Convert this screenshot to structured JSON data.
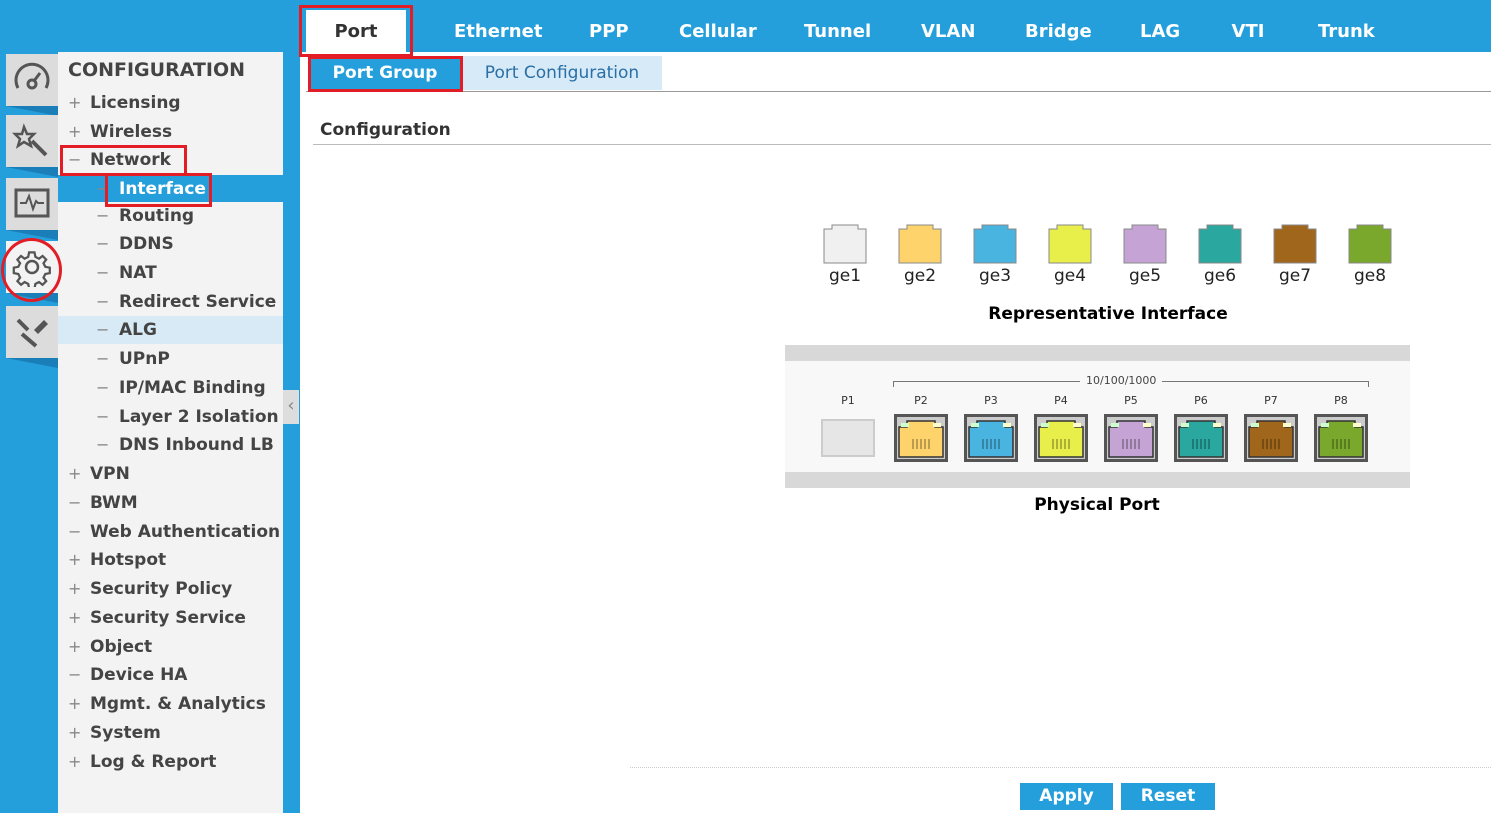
{
  "tabs": [
    "Port",
    "Ethernet",
    "PPP",
    "Cellular",
    "Tunnel",
    "VLAN",
    "Bridge",
    "LAG",
    "VTI",
    "Trunk"
  ],
  "subtabs": [
    "Port Group",
    "Port Configuration"
  ],
  "sidebar": {
    "title": "CONFIGURATION",
    "items": [
      {
        "label": "Licensing",
        "sign": "+",
        "level": 0
      },
      {
        "label": "Wireless",
        "sign": "+",
        "level": 0
      },
      {
        "label": "Network",
        "sign": "−",
        "level": 0
      },
      {
        "label": "Interface",
        "sign": "−",
        "level": 1,
        "selected": true
      },
      {
        "label": "Routing",
        "sign": "−",
        "level": 1
      },
      {
        "label": "DDNS",
        "sign": "−",
        "level": 1
      },
      {
        "label": "NAT",
        "sign": "−",
        "level": 1
      },
      {
        "label": "Redirect Service",
        "sign": "−",
        "level": 1
      },
      {
        "label": "ALG",
        "sign": "−",
        "level": 1,
        "hover": true
      },
      {
        "label": "UPnP",
        "sign": "−",
        "level": 1
      },
      {
        "label": "IP/MAC Binding",
        "sign": "−",
        "level": 1
      },
      {
        "label": "Layer 2 Isolation",
        "sign": "−",
        "level": 1
      },
      {
        "label": "DNS Inbound LB",
        "sign": "−",
        "level": 1
      },
      {
        "label": "VPN",
        "sign": "+",
        "level": 0
      },
      {
        "label": "BWM",
        "sign": "−",
        "level": 0
      },
      {
        "label": "Web Authentication",
        "sign": "−",
        "level": 0
      },
      {
        "label": "Hotspot",
        "sign": "+",
        "level": 0
      },
      {
        "label": "Security Policy",
        "sign": "+",
        "level": 0
      },
      {
        "label": "Security Service",
        "sign": "+",
        "level": 0
      },
      {
        "label": "Object",
        "sign": "+",
        "level": 0
      },
      {
        "label": "Device HA",
        "sign": "−",
        "level": 0
      },
      {
        "label": "Mgmt. & Analytics",
        "sign": "+",
        "level": 0
      },
      {
        "label": "System",
        "sign": "+",
        "level": 0
      },
      {
        "label": "Log & Report",
        "sign": "+",
        "level": 0
      }
    ]
  },
  "icons": [
    "dashboard-icon",
    "wizard-icon",
    "monitor-icon",
    "gear-icon",
    "maintenance-icon"
  ],
  "main": {
    "section_title": "Configuration",
    "rep_caption": "Representative Interface",
    "phys_caption": "Physical Port",
    "speed_label": "10/100/1000",
    "interfaces": [
      {
        "name": "ge1",
        "color": "#f0f0f0"
      },
      {
        "name": "ge2",
        "color": "#ffd36b"
      },
      {
        "name": "ge3",
        "color": "#4ab4e0"
      },
      {
        "name": "ge4",
        "color": "#e8ef4a"
      },
      {
        "name": "ge5",
        "color": "#c5a3d5"
      },
      {
        "name": "ge6",
        "color": "#2aa79f"
      },
      {
        "name": "ge7",
        "color": "#a0661c"
      },
      {
        "name": "ge8",
        "color": "#7aa82c"
      }
    ],
    "ports": [
      {
        "name": "P1",
        "color": "#e6e6e6"
      },
      {
        "name": "P2",
        "color": "#ffd36b"
      },
      {
        "name": "P3",
        "color": "#4ab4e0"
      },
      {
        "name": "P4",
        "color": "#e8ef4a"
      },
      {
        "name": "P5",
        "color": "#c5a3d5"
      },
      {
        "name": "P6",
        "color": "#2aa79f"
      },
      {
        "name": "P7",
        "color": "#a0661c"
      },
      {
        "name": "P8",
        "color": "#7aa82c"
      }
    ],
    "apply": "Apply",
    "reset": "Reset"
  },
  "colors": {
    "accent": "#259fdb",
    "highlight": "#e31d25"
  }
}
